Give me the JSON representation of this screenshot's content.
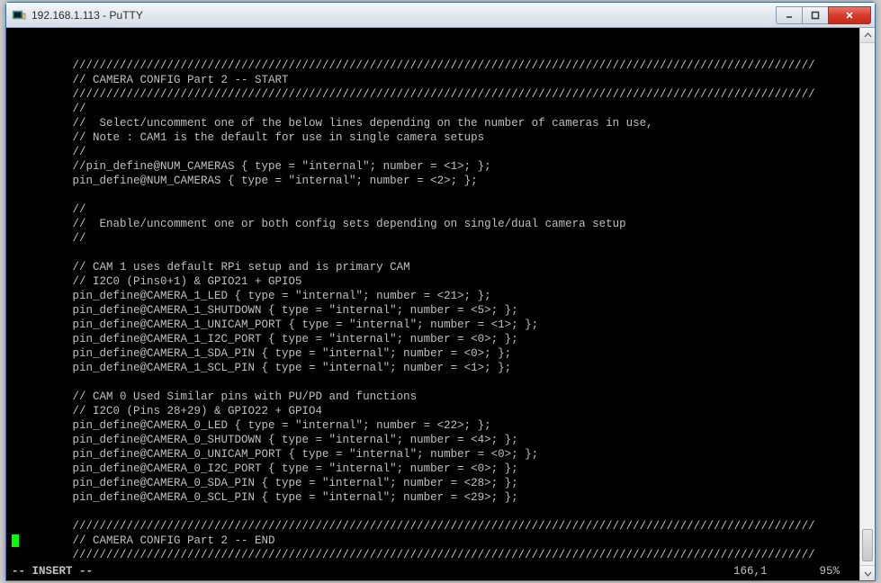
{
  "window": {
    "title": "192.168.1.113 - PuTTY"
  },
  "code": {
    "lines": [
      "//////////////////////////////////////////////////////////////////////////////////////////////////////////////",
      "// CAMERA CONFIG Part 2 -- START",
      "//////////////////////////////////////////////////////////////////////////////////////////////////////////////",
      "//",
      "//  Select/uncomment one of the below lines depending on the number of cameras in use,",
      "// Note : CAM1 is the default for use in single camera setups",
      "//",
      "//pin_define@NUM_CAMERAS { type = \"internal\"; number = <1>; };",
      "pin_define@NUM_CAMERAS { type = \"internal\"; number = <2>; };",
      "",
      "//",
      "//  Enable/uncomment one or both config sets depending on single/dual camera setup",
      "//",
      "",
      "// CAM 1 uses default RPi setup and is primary CAM",
      "// I2C0 (Pins0+1) & GPIO21 + GPIO5",
      "pin_define@CAMERA_1_LED { type = \"internal\"; number = <21>; };",
      "pin_define@CAMERA_1_SHUTDOWN { type = \"internal\"; number = <5>; };",
      "pin_define@CAMERA_1_UNICAM_PORT { type = \"internal\"; number = <1>; };",
      "pin_define@CAMERA_1_I2C_PORT { type = \"internal\"; number = <0>; };",
      "pin_define@CAMERA_1_SDA_PIN { type = \"internal\"; number = <0>; };",
      "pin_define@CAMERA_1_SCL_PIN { type = \"internal\"; number = <1>; };",
      "",
      "// CAM 0 Used Similar pins with PU/PD and functions",
      "// I2C0 (Pins 28+29) & GPIO22 + GPIO4",
      "pin_define@CAMERA_0_LED { type = \"internal\"; number = <22>; };",
      "pin_define@CAMERA_0_SHUTDOWN { type = \"internal\"; number = <4>; };",
      "pin_define@CAMERA_0_UNICAM_PORT { type = \"internal\"; number = <0>; };",
      "pin_define@CAMERA_0_I2C_PORT { type = \"internal\"; number = <0>; };",
      "pin_define@CAMERA_0_SDA_PIN { type = \"internal\"; number = <28>; };",
      "pin_define@CAMERA_0_SCL_PIN { type = \"internal\"; number = <29>; };",
      "",
      "//////////////////////////////////////////////////////////////////////////////////////////////////////////////",
      "// CAMERA CONFIG Part 2 -- END",
      "//////////////////////////////////////////////////////////////////////////////////////////////////////////////"
    ],
    "gutter_pad": "         "
  },
  "status": {
    "mode": "-- INSERT --",
    "ruler": "166,1",
    "percent": "95%"
  }
}
